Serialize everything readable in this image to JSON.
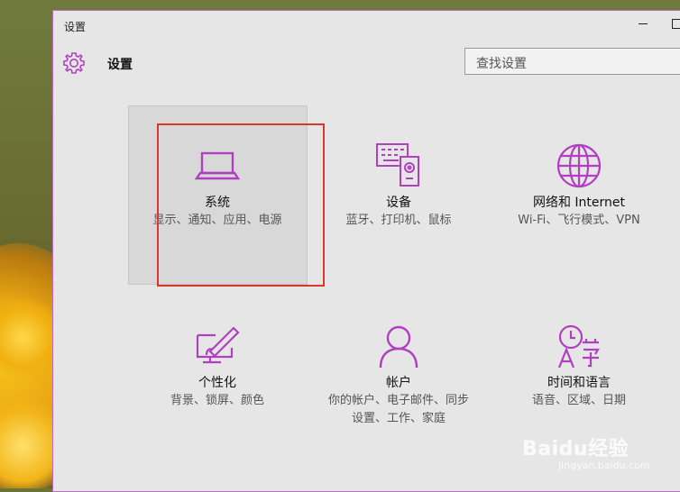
{
  "window": {
    "title": "设置"
  },
  "header": {
    "title": "设置",
    "icon": "gear-icon"
  },
  "search": {
    "placeholder": "查找设置"
  },
  "accent_color": "#b040c0",
  "highlight_color": "#d9362d",
  "tiles": [
    {
      "icon": "laptop-icon",
      "title": "系统",
      "desc": "显示、通知、应用、电源"
    },
    {
      "icon": "devices-icon",
      "title": "设备",
      "desc": "蓝牙、打印机、鼠标"
    },
    {
      "icon": "globe-icon",
      "title": "网络和 Internet",
      "desc": "Wi-Fi、飞行模式、VPN"
    },
    {
      "icon": "personalization-icon",
      "title": "个性化",
      "desc": "背景、锁屏、颜色"
    },
    {
      "icon": "account-icon",
      "title": "帐户",
      "desc": "你的帐户、电子邮件、同步设置、工作、家庭"
    },
    {
      "icon": "time-language-icon",
      "title": "时间和语言",
      "desc": "语音、区域、日期"
    }
  ],
  "watermark": {
    "logo": "Baidu经验",
    "url": "jingyan.baidu.com"
  }
}
